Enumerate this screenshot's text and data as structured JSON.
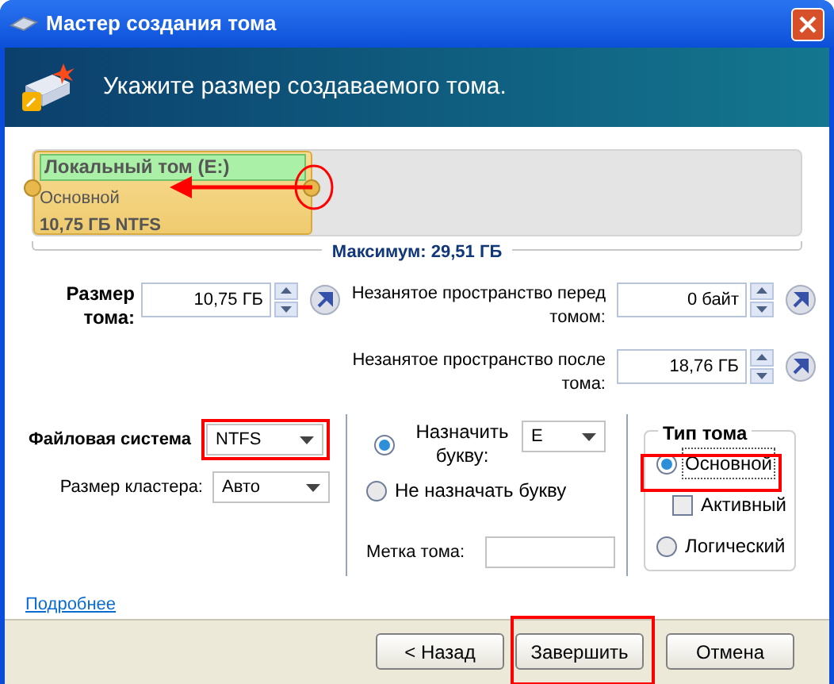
{
  "window": {
    "title": "Мастер создания тома"
  },
  "header": {
    "title": "Укажите размер создаваемого тома."
  },
  "partition": {
    "label": "Локальный том (E:)",
    "type": "Основной",
    "size": "10,75 ГБ NTFS",
    "level": 0.364,
    "maximum": "Максимум: 29,51 ГБ"
  },
  "volume_size": {
    "label": "Размер тома:",
    "value": "10,75 ГБ"
  },
  "unallocated": [
    {
      "label": "Незанятое пространство перед томом:",
      "value": "0 байт"
    },
    {
      "label": "Незанятое пространство после тома:",
      "value": "18,76 ГБ"
    }
  ],
  "file_system": {
    "label": "Файловая система",
    "value": "NTFS"
  },
  "cluster_size": {
    "label": "Размер кластера:",
    "value": "Авто"
  },
  "drive_letter": {
    "options": [
      {
        "label": "Назначить букву:",
        "selected": true
      },
      {
        "label": "Не назначать букву",
        "selected": false
      }
    ],
    "letter": "E"
  },
  "volume_label": {
    "label": "Метка тома:"
  },
  "volume_type": {
    "title": "Тип тома",
    "options": [
      {
        "kind": "radio",
        "label": "Основной",
        "selected": true
      },
      {
        "kind": "checkbox",
        "label": "Активный",
        "checked": false
      },
      {
        "kind": "radio",
        "label": "Логический",
        "selected": false
      }
    ]
  },
  "more_link": "Подробнее",
  "buttons": [
    {
      "label": "< Назад"
    },
    {
      "label": "Завершить"
    },
    {
      "label": "Отмена"
    }
  ]
}
